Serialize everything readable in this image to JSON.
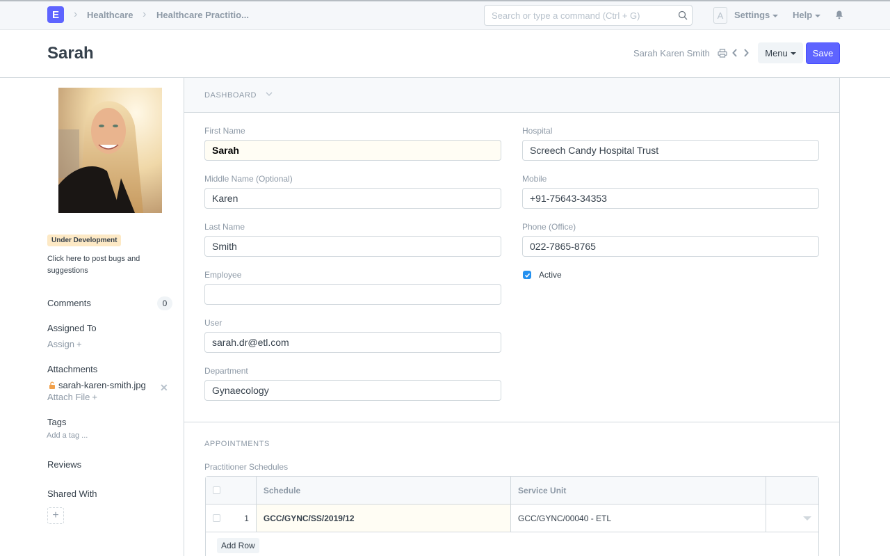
{
  "navbar": {
    "logo_letter": "E",
    "breadcrumbs": [
      "Healthcare",
      "Healthcare Practitio..."
    ],
    "search_placeholder": "Search or type a command (Ctrl + G)",
    "avatar_letter": "A",
    "settings_label": "Settings",
    "help_label": "Help"
  },
  "page_head": {
    "title": "Sarah",
    "full_name": "Sarah Karen Smith",
    "menu_label": "Menu",
    "save_label": "Save",
    "accent_color": "#5e64ff"
  },
  "sidebar": {
    "badge": "Under Development",
    "bug_link": "Click here to post bugs and suggestions",
    "comments_label": "Comments",
    "comments_count": "0",
    "assigned_to_label": "Assigned To",
    "assign_label": "Assign",
    "attachments_label": "Attachments",
    "attachment_file": "sarah-karen-smith.jpg",
    "attach_file_label": "Attach File",
    "tags_label": "Tags",
    "tag_placeholder": "Add a tag ...",
    "reviews_label": "Reviews",
    "shared_with_label": "Shared With"
  },
  "form": {
    "dashboard_section": "DASHBOARD",
    "fields_left": [
      {
        "label": "First Name",
        "value": "Sarah"
      },
      {
        "label": "Middle Name (Optional)",
        "value": "Karen"
      },
      {
        "label": "Last Name",
        "value": "Smith"
      },
      {
        "label": "Employee",
        "value": ""
      },
      {
        "label": "User",
        "value": "sarah.dr@etl.com"
      },
      {
        "label": "Department",
        "value": "Gynaecology"
      }
    ],
    "fields_right": [
      {
        "label": "Hospital",
        "value": "Screech Candy Hospital Trust"
      },
      {
        "label": "Mobile",
        "value": "+91-75643-34353"
      },
      {
        "label": "Phone (Office)",
        "value": "022-7865-8765"
      }
    ],
    "active_label": "Active",
    "active_checked": true,
    "appointments_section": "APPOINTMENTS",
    "schedules_label": "Practitioner Schedules",
    "table": {
      "columns": [
        "Schedule",
        "Service Unit"
      ],
      "rows": [
        {
          "index": "1",
          "schedule": "GCC/GYNC/SS/2019/12",
          "service_unit": "GCC/GYNC/00040 - ETL"
        }
      ],
      "add_row_label": "Add Row"
    }
  }
}
